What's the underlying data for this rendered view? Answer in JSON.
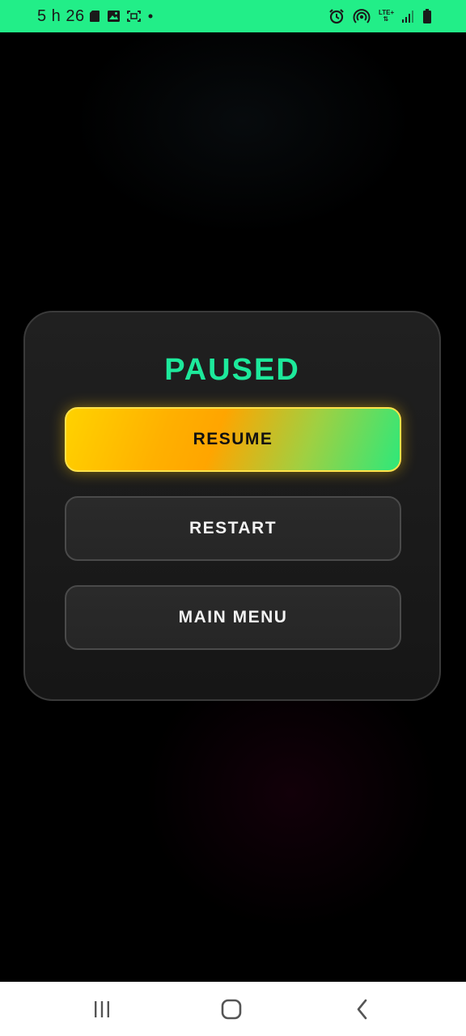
{
  "status_bar": {
    "time": "5 h 26",
    "lte_label": "LTE+",
    "left_icons": [
      "sd-card-icon",
      "image-icon",
      "screenshot-icon",
      "dot-icon"
    ],
    "right_icons": [
      "alarm-icon",
      "hotspot-icon",
      "lte-icon",
      "signal-icon",
      "battery-icon"
    ],
    "background_color": "#22ee88"
  },
  "pause_menu": {
    "title": "PAUSED",
    "title_color": "#1de99b",
    "buttons": [
      {
        "label": "RESUME",
        "style": "primary-gradient"
      },
      {
        "label": "RESTART",
        "style": "secondary"
      },
      {
        "label": "MAIN MENU",
        "style": "secondary"
      }
    ]
  },
  "nav_bar": {
    "buttons": [
      "recent-apps-icon",
      "home-icon",
      "back-icon"
    ]
  }
}
